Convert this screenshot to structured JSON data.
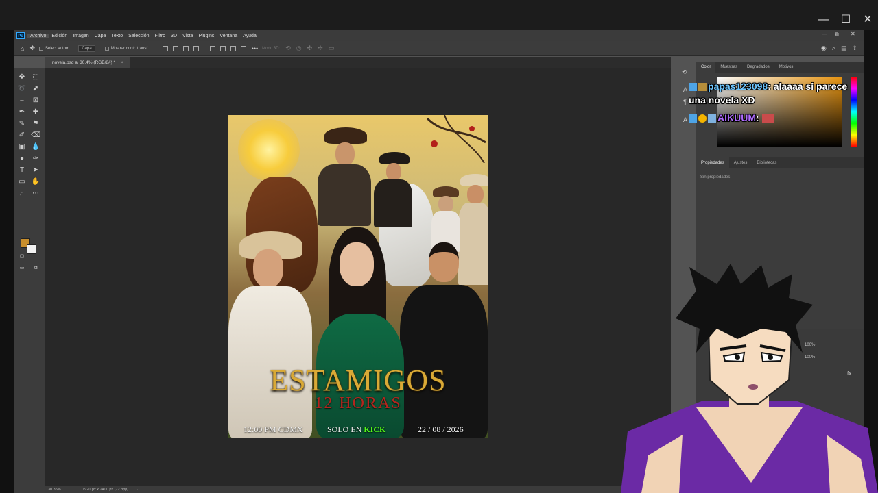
{
  "menu": {
    "items": [
      "Archivo",
      "Edición",
      "Imagen",
      "Capa",
      "Texto",
      "Selección",
      "Filtro",
      "3D",
      "Vista",
      "Plugins",
      "Ventana",
      "Ayuda"
    ],
    "active": "Archivo"
  },
  "options_bar": {
    "auto_select_label": "Selec. autom.:",
    "auto_select_value": "Capa",
    "show_transform_label": "Mostrar contr. transf.",
    "mode_3d_label": "Modo 3D:"
  },
  "document": {
    "tab_title": "novela.psd al 30.4% (RGB/8#) *"
  },
  "status": {
    "zoom": "30.35%",
    "doc_info": "1920 px x 2400 px (72 ppp)"
  },
  "poster": {
    "title": "ESTAMIGOS",
    "subtitle": "12 HORAS",
    "time": "12:00 PM CDMX",
    "solo_en": "SOLO EN",
    "platform": "KICK",
    "date": "22 / 08 / 2026"
  },
  "panels": {
    "color_tabs": [
      "Color",
      "Muestras",
      "Degradados",
      "Motivos"
    ],
    "props_tabs": [
      "Propiedades",
      "Ajustes",
      "Bibliotecas"
    ],
    "props_empty": "Sin propiedades",
    "opacity_value": "100%",
    "fill_value": "100%"
  },
  "chat": {
    "messages": [
      {
        "user": "papas123098",
        "text": "alaaaa si parece una novela XD"
      },
      {
        "user": "AIKUUM",
        "text": ""
      }
    ]
  },
  "colors": {
    "foreground": "#c88e2c",
    "background": "#f2f2f2",
    "kick_green": "#53fc18",
    "title_gold": "#d9a936",
    "subtitle_red": "#b3261e"
  }
}
